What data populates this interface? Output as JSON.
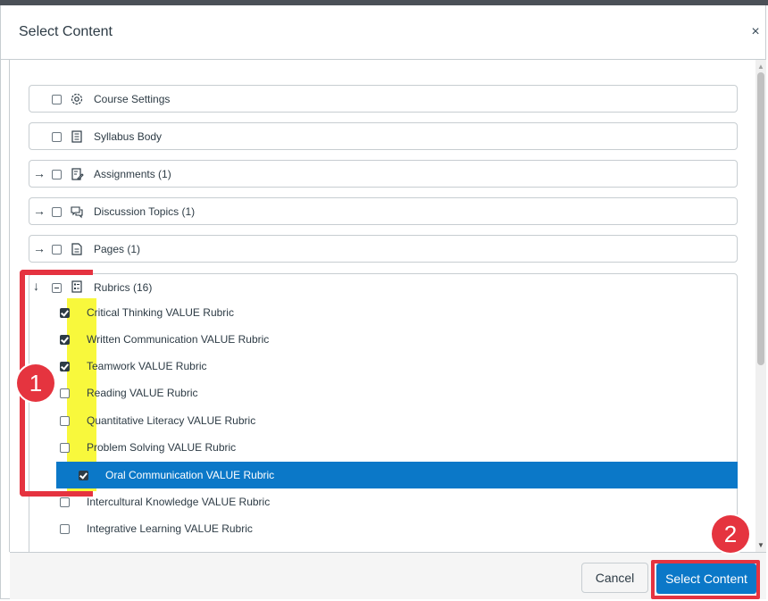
{
  "dialog": {
    "title": "Select Content",
    "close_glyph": "×"
  },
  "tree": {
    "collapsed_arrow": "→",
    "expanded_arrow": "↓",
    "items": [
      {
        "label": "Course Settings",
        "icon": "gear-icon"
      },
      {
        "label": "Syllabus Body",
        "icon": "syllabus-icon"
      },
      {
        "label": "Assignments (1)",
        "icon": "assignment-icon"
      },
      {
        "label": "Discussion Topics (1)",
        "icon": "discussion-icon"
      },
      {
        "label": "Pages (1)",
        "icon": "pages-icon"
      }
    ],
    "rubrics": {
      "label": "Rubrics (16)",
      "icon": "rubric-icon",
      "items": [
        {
          "label": "Critical Thinking VALUE Rubric",
          "checked": true
        },
        {
          "label": "Written Communication VALUE Rubric",
          "checked": true
        },
        {
          "label": "Teamwork VALUE Rubric",
          "checked": true
        },
        {
          "label": "Reading VALUE Rubric",
          "checked": false
        },
        {
          "label": "Quantitative Literacy VALUE Rubric",
          "checked": false
        },
        {
          "label": "Problem Solving VALUE Rubric",
          "checked": false
        },
        {
          "label": "Oral Communication VALUE Rubric",
          "checked": true,
          "selected": true
        },
        {
          "label": "Intercultural Knowledge VALUE Rubric",
          "checked": false
        },
        {
          "label": "Integrative Learning VALUE Rubric",
          "checked": false
        }
      ]
    }
  },
  "annotations": {
    "badge_1": "1",
    "badge_2": "2",
    "highlight_color": "#f8f83c",
    "marker_color": "#e53340"
  },
  "footer": {
    "cancel_label": "Cancel",
    "select_label": "Select Content"
  },
  "colors": {
    "selected_row": "#0b78c8",
    "primary_button": "#0b78c8"
  }
}
